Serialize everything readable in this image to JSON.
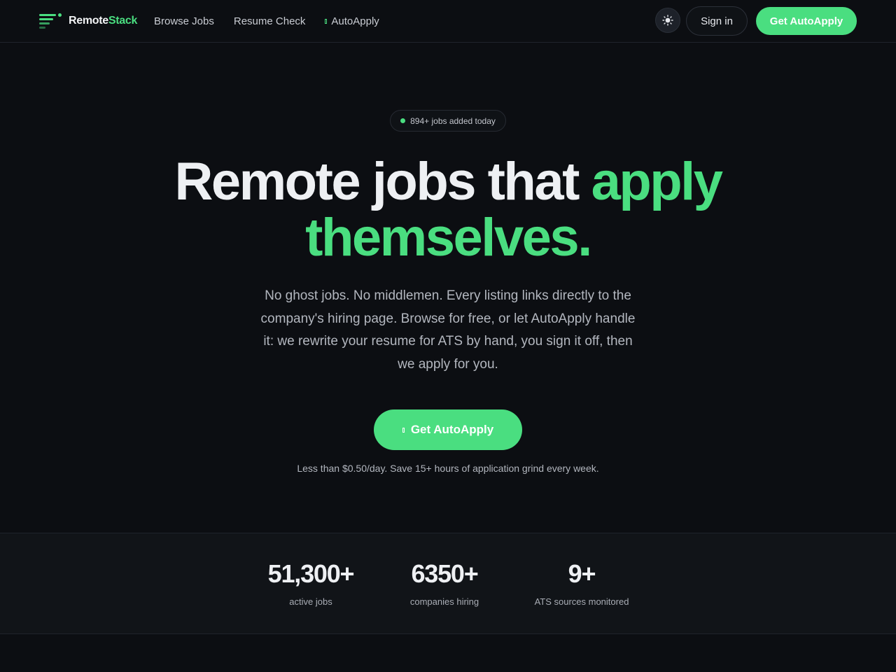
{
  "nav": {
    "logo_part1": "Remote",
    "logo_part2": "Stack",
    "links": [
      "Browse Jobs",
      "Resume Check",
      "AutoApply"
    ],
    "signin_label": "Sign in",
    "cta_label": "Get AutoApply"
  },
  "hero": {
    "badge": "894+ jobs added today",
    "headline_white": "Remote jobs that ",
    "headline_green1": "apply",
    "headline_green2": "themselves.",
    "subtext": "No ghost jobs. No middlemen. Every listing links directly to the company's hiring page. Browse for free, or let AutoApply handle it: we rewrite your resume for ATS by hand, you sign it off, then we apply for you.",
    "cta_label": "Get AutoApply",
    "price_note": "Less than $0.50/day. Save 15+ hours of application grind every week."
  },
  "stats": [
    {
      "value": "51,300+",
      "label": "active jobs"
    },
    {
      "value": "6350+",
      "label": "companies hiring"
    },
    {
      "value": "9+",
      "label": "ATS sources monitored"
    }
  ],
  "colors": {
    "background": "#0c0e12",
    "accent": "#4ade80",
    "stats_band": "#111418"
  },
  "icons": {
    "logo": "stacked-lines-logo-icon",
    "theme": "sun-icon",
    "autoapply": "sparkle-icon"
  }
}
